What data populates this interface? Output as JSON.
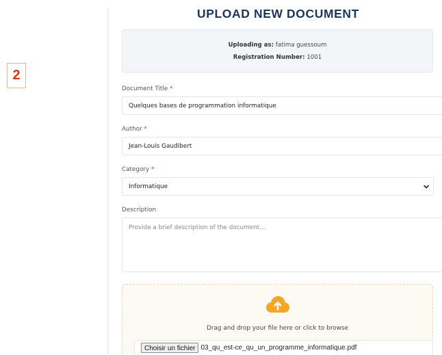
{
  "step_marker": "2",
  "form": {
    "title": "UPLOAD NEW DOCUMENT",
    "uploader": {
      "label": "Uploading as:",
      "name": "fatima guessoum",
      "reg_label": "Registration Number:",
      "reg_number": "1001"
    },
    "fields": {
      "title": {
        "label": "Document Title",
        "required_mark": "*",
        "value": "Quelques bases de programmation informatique"
      },
      "author": {
        "label": "Author",
        "required_mark": "*",
        "value": "Jean-Louis Gaudibert"
      },
      "category": {
        "label": "Category",
        "required_mark": "*",
        "value": "Informatique"
      },
      "description": {
        "label": "Description",
        "placeholder": "Provide a brief description of the document..."
      }
    },
    "upload": {
      "instruction": "Drag and drop your file here or click to browse",
      "choose_button": "Choisir un fichier",
      "file_name": "03_qu_est-ce_qu_un_programme_informatique.pdf"
    }
  },
  "colors": {
    "title": "#1d3557",
    "required": "#dd3333",
    "step_marker": "#d93418",
    "upload_icon": "#f5a623",
    "dropzone_bg": "#fcfaf2"
  },
  "icons": {
    "upload": "cloud-upload-icon",
    "select_arrow": "chevron-down-icon"
  }
}
